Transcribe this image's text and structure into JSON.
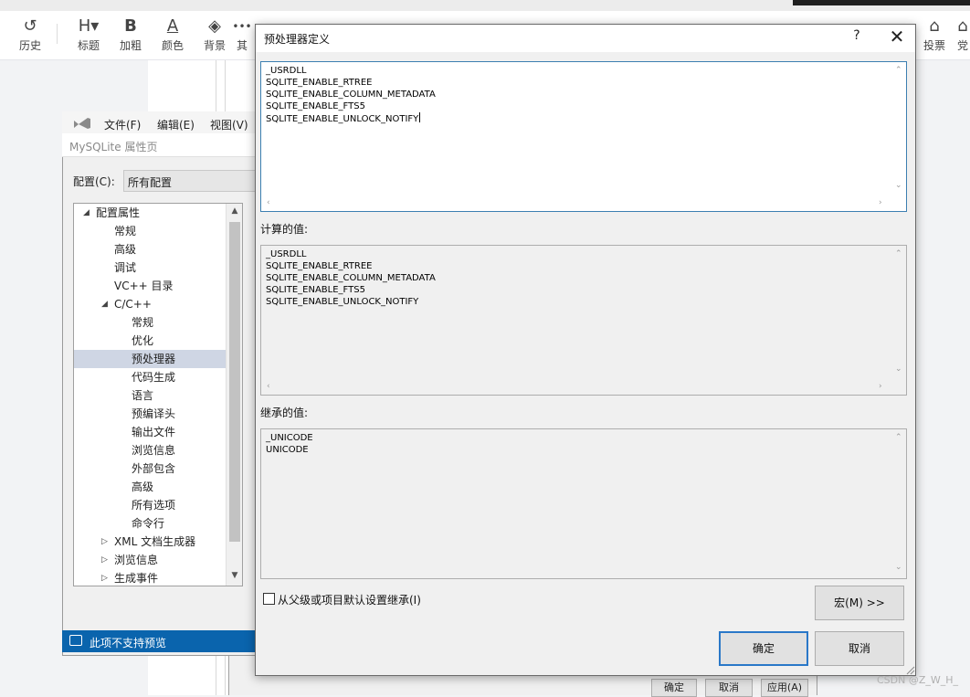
{
  "toolbar": {
    "items": [
      {
        "icon": "history-icon",
        "glyph": "↺",
        "label": "历史"
      },
      {
        "icon": "heading-icon",
        "glyph": "H▾",
        "label": "标题"
      },
      {
        "icon": "bold-icon",
        "glyph": "B",
        "label": "加粗"
      },
      {
        "icon": "text-color-icon",
        "glyph": "A",
        "label": "颜色"
      },
      {
        "icon": "background-icon",
        "glyph": "◈",
        "label": "背景"
      },
      {
        "icon": "more-icon",
        "glyph": "•••",
        "label": "其"
      }
    ],
    "right_items": [
      {
        "icon": "vote-icon",
        "glyph": "⌂",
        "label": "投票"
      },
      {
        "icon": "share-icon",
        "glyph": "⌂",
        "label": "党"
      }
    ]
  },
  "vs": {
    "menu": {
      "file": "文件(F)",
      "edit": "编辑(E)",
      "view": "视图(V)"
    },
    "window_title": "MySQLite 属性页",
    "config_label": "配置(C):",
    "config_value": "所有配置",
    "tree": [
      {
        "label": "配置属性",
        "level": 0,
        "arrow": "◢",
        "selected": false
      },
      {
        "label": "常规",
        "level": 1,
        "arrow": "",
        "selected": false
      },
      {
        "label": "高级",
        "level": 1,
        "arrow": "",
        "selected": false
      },
      {
        "label": "调试",
        "level": 1,
        "arrow": "",
        "selected": false
      },
      {
        "label": "VC++ 目录",
        "level": 1,
        "arrow": "",
        "selected": false
      },
      {
        "label": "C/C++",
        "level": 1,
        "arrow": "◢",
        "selected": false
      },
      {
        "label": "常规",
        "level": 2,
        "arrow": "",
        "selected": false
      },
      {
        "label": "优化",
        "level": 2,
        "arrow": "",
        "selected": false
      },
      {
        "label": "预处理器",
        "level": 2,
        "arrow": "",
        "selected": true
      },
      {
        "label": "代码生成",
        "level": 2,
        "arrow": "",
        "selected": false
      },
      {
        "label": "语言",
        "level": 2,
        "arrow": "",
        "selected": false
      },
      {
        "label": "预编译头",
        "level": 2,
        "arrow": "",
        "selected": false
      },
      {
        "label": "输出文件",
        "level": 2,
        "arrow": "",
        "selected": false
      },
      {
        "label": "浏览信息",
        "level": 2,
        "arrow": "",
        "selected": false
      },
      {
        "label": "外部包含",
        "level": 2,
        "arrow": "",
        "selected": false
      },
      {
        "label": "高级",
        "level": 2,
        "arrow": "",
        "selected": false
      },
      {
        "label": "所有选项",
        "level": 2,
        "arrow": "",
        "selected": false
      },
      {
        "label": "命令行",
        "level": 2,
        "arrow": "",
        "selected": false
      },
      {
        "label": "XML 文档生成器",
        "level": 1,
        "arrow": "▷",
        "selected": false
      },
      {
        "label": "浏览信息",
        "level": 1,
        "arrow": "▷",
        "selected": false
      },
      {
        "label": "生成事件",
        "level": 1,
        "arrow": "▷",
        "selected": false
      }
    ],
    "status": "此项不支持预览",
    "back_buttons": {
      "ok": "确定",
      "cancel": "取消",
      "apply": "应用(A)"
    }
  },
  "dialog": {
    "title": "预处理器定义",
    "help": "?",
    "close": "✕",
    "definitions": "_USRDLL\nSQLITE_ENABLE_RTREE\nSQLITE_ENABLE_COLUMN_METADATA\nSQLITE_ENABLE_FTS5\nSQLITE_ENABLE_UNLOCK_NOTIFY",
    "evaluated_label": "计算的值:",
    "evaluated": "_USRDLL\nSQLITE_ENABLE_RTREE\nSQLITE_ENABLE_COLUMN_METADATA\nSQLITE_ENABLE_FTS5\nSQLITE_ENABLE_UNLOCK_NOTIFY",
    "inherited_label": "继承的值:",
    "inherited": "_UNICODE\nUNICODE",
    "inherit_checkbox_label": "从父级或项目默认设置继承(I)",
    "inherit_checked": false,
    "macros_button": "宏(M) >>",
    "ok_button": "确定",
    "cancel_button": "取消"
  },
  "watermark": "CSDN @Z_W_H_"
}
